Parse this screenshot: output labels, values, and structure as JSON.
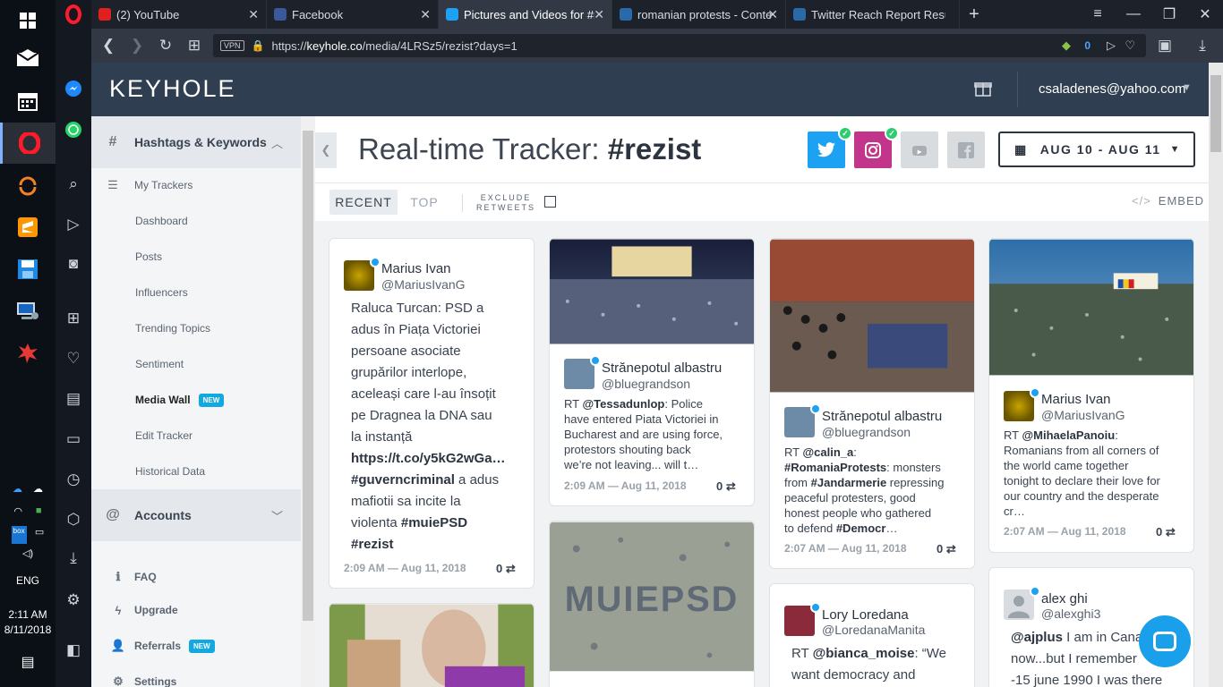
{
  "taskbar": {
    "time": "2:11 AM",
    "date": "8/11/2018",
    "lang": "ENG"
  },
  "browser": {
    "tabs": [
      {
        "label": "(2) YouTube",
        "color": "#e02020"
      },
      {
        "label": "Facebook",
        "color": "#3b5998"
      },
      {
        "label": "Pictures and Videos for #r",
        "color": "#1da1f2"
      },
      {
        "label": "romanian protests - Conte",
        "color": "#2a6aa8"
      },
      {
        "label": "Twitter Reach Report Resul",
        "color": "#2a6aa8"
      }
    ],
    "new_tab": "+",
    "vpn": "VPN",
    "url_prefix": "https://",
    "url_host": "keyhole.co",
    "url_path": "/media/4LRSz5/rezist?days=1",
    "badge_count": "0"
  },
  "header": {
    "logo": "KEYHOLE",
    "user_email": "csaladenes@yahoo.com"
  },
  "sidebar": {
    "section1": "Hashtags & Keywords",
    "my_trackers": "My Trackers",
    "items": [
      "Dashboard",
      "Posts",
      "Influencers",
      "Trending Topics",
      "Sentiment",
      "Media Wall",
      "Edit Tracker",
      "Historical Data"
    ],
    "new_badge": "NEW",
    "section2": "Accounts",
    "bottom": [
      "FAQ",
      "Upgrade",
      "Referrals",
      "Settings"
    ]
  },
  "main": {
    "title_prefix": "Real-time Tracker: ",
    "title_tag": "#rezist",
    "date_range": "AUG 10 - AUG 11",
    "tab_recent": "RECENT",
    "tab_top": "TOP",
    "exclude_line1": "EXCLUDE",
    "exclude_line2": "RETWEETS",
    "embed": "EMBED"
  },
  "cards": {
    "c1": {
      "name": "Marius Ivan",
      "handle": "@MariusIvanG",
      "t1": "Raluca Turcan: PSD a\nadus în Piața Victoriei\npersoane asociate\ngrupărilor interlope,\naceleași care l-au însoțit\npe Dragnea la DNA sau\nla instanță ",
      "link": "https://t.co/y5kG2wGa…",
      "tag1": "#guverncriminal",
      "t2": " a adus\nmafiotii sa incite la\nviolenta ",
      "tag2": "#muiePSD",
      "tag3": "#rezist",
      "date": "2:09 AM — Aug 11, 2018",
      "rt": "0"
    },
    "c2": {
      "name": "Strănepotul albastru",
      "handle": "@bluegrandson",
      "rt_prefix": "RT ",
      "mention": "@Tessadunlop",
      "text": ": Police\nhave entered Piata Victoriei in\nBucharest and are using force,\nprotestors shouting back\nwe’re not leaving... will t…",
      "date": "2:09 AM — Aug 11, 2018",
      "rt": "0"
    },
    "c3": {
      "name": "Strănepotul albastru",
      "handle": "@bluegrandson",
      "rt_prefix": "RT ",
      "mention": "@calin_a",
      "t1": ":\n",
      "tag1": "#RomaniaProtests",
      "t2": ": monsters\nfrom ",
      "tag2": "#Jandarmerie",
      "t3": " repressing\npeaceful protesters, good\nhonest people who gathered\nto defend ",
      "tag3": "#Democr",
      "t4": "…",
      "date": "2:07 AM — Aug 11, 2018",
      "rt": "0"
    },
    "c4": {
      "name": "Marius Ivan",
      "handle": "@MariusIvanG",
      "rt_prefix": "RT ",
      "mention": "@MihaelaPanoiu",
      "text": ":\nRomanians from all corners of\nthe world came together\ntonight to declare their love for\nour country and the desperate\ncr…",
      "date": "2:07 AM — Aug 11, 2018",
      "rt": "0"
    },
    "c5": {
      "name": "Lory Loredana",
      "handle": "@LoredanaManita",
      "rt_prefix": "RT ",
      "mention": "@bianca_moise",
      "text": ": “We\nwant democracy and"
    },
    "c6": {
      "name": "alex ghi",
      "handle": "@alexghi3",
      "mention": "@ajplus",
      "text": " I am in Cana\nnow...but I remember\n-15 june 1990 I was there"
    },
    "photo_text": "MUIEPSD"
  }
}
